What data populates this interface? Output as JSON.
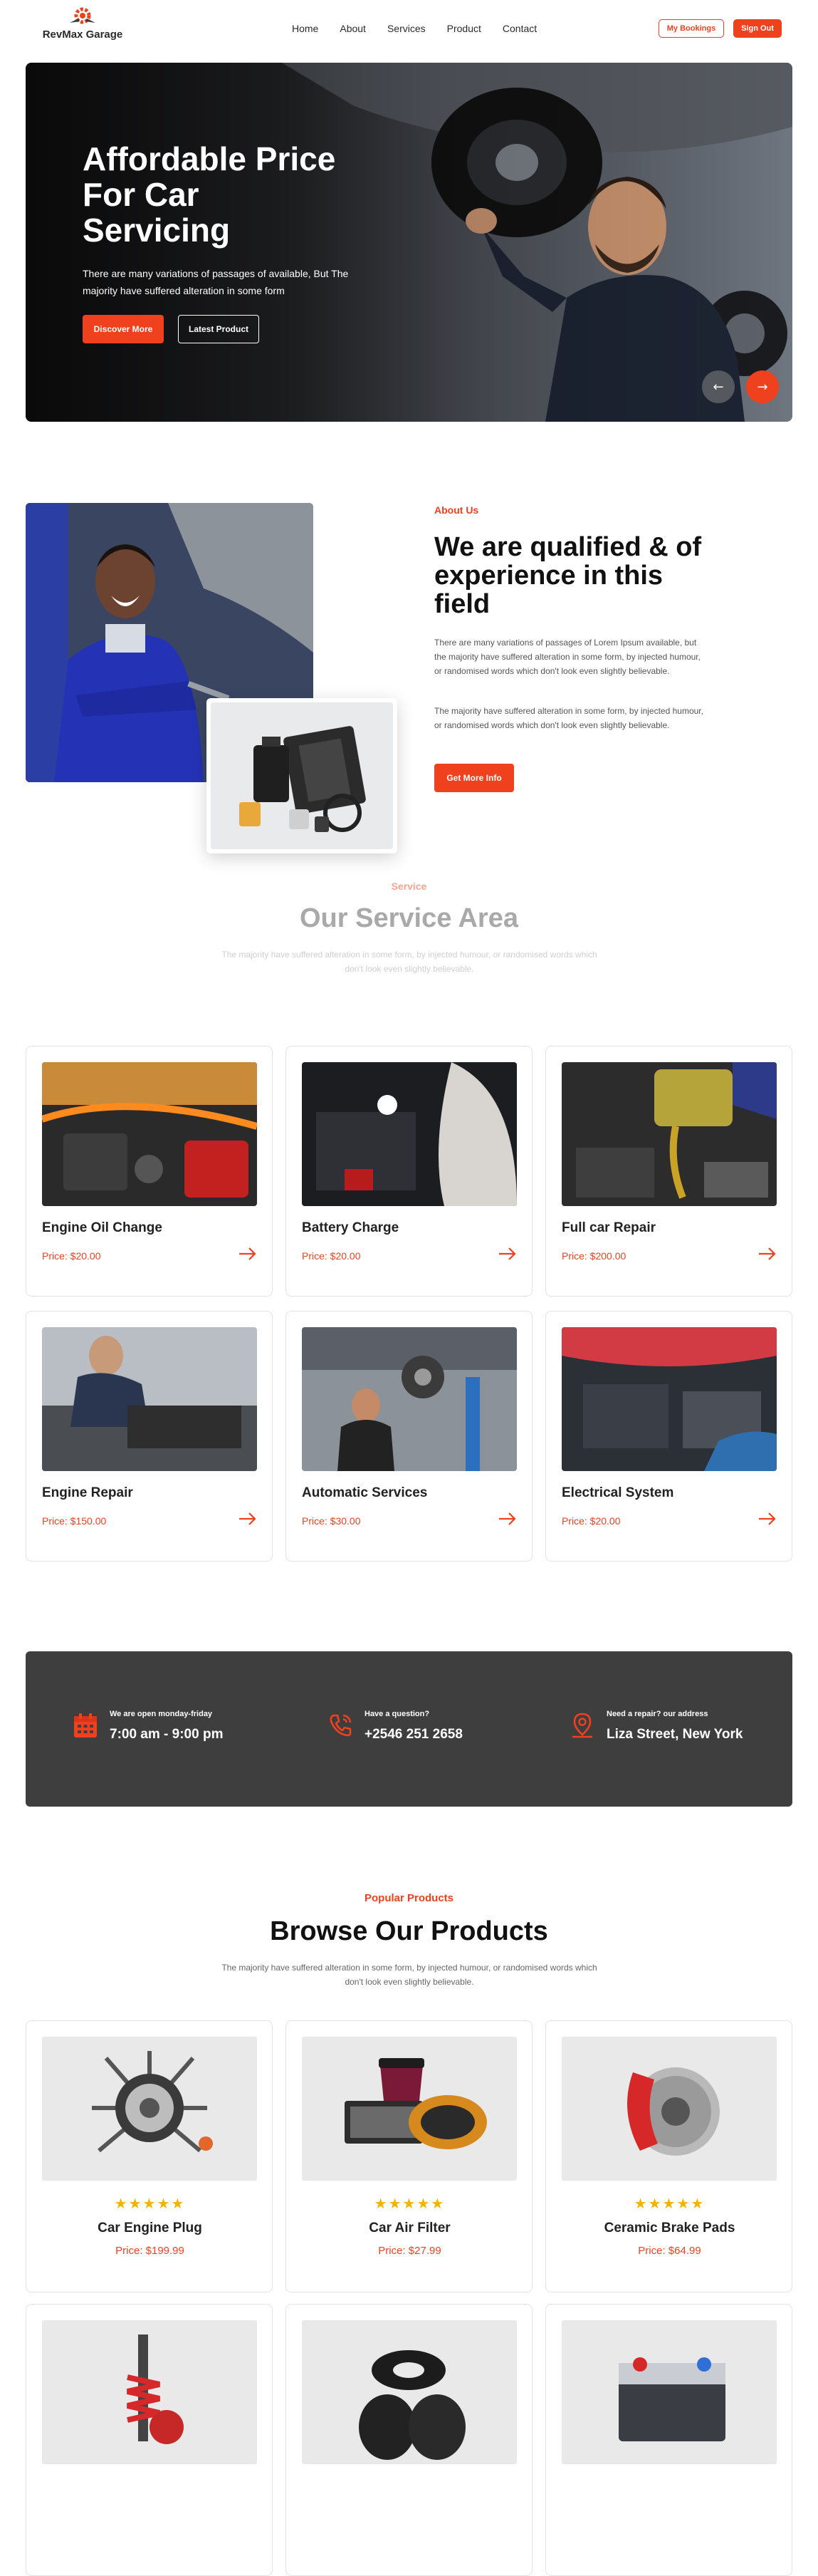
{
  "brand": {
    "name": "RevMax Garage",
    "accent": "#f0411f"
  },
  "nav": {
    "items": [
      "Home",
      "About",
      "Services",
      "Product",
      "Contact"
    ]
  },
  "header_buttons": {
    "bookings": "My Bookings",
    "signout": "Sign Out"
  },
  "hero": {
    "title": "Affordable Price For Car Servicing",
    "text": "There are many variations of passages of available, But The majority have suffered alteration in some form",
    "primary_button": "Discover More",
    "secondary_button": "Latest Product",
    "prev_icon": "arrow-left-icon",
    "next_icon": "arrow-right-icon"
  },
  "about": {
    "tag": "About Us",
    "title": "We are qualified & of experience in this field",
    "p1": "There are many variations of passages of Lorem Ipsum available, but the majority have suffered alteration in some form, by injected humour, or randomised words which don't look even slightly believable.",
    "p2": "The majority have suffered alteration in some form, by injected humour, or randomised words which don't look even slightly believable.",
    "button": "Get More Info"
  },
  "services": {
    "tag": "Service",
    "title": "Our Service Area",
    "subtitle": "The majority have suffered alteration in some form, by injected humour, or randomised words which don't look even slightly believable.",
    "items": [
      {
        "name": "Engine Oil Change",
        "price": "Price: $20.00"
      },
      {
        "name": "Battery Charge",
        "price": "Price: $20.00"
      },
      {
        "name": "Full car Repair",
        "price": "Price: $200.00"
      },
      {
        "name": "Engine Repair",
        "price": "Price: $150.00"
      },
      {
        "name": "Automatic Services",
        "price": "Price: $30.00"
      },
      {
        "name": "Electrical System",
        "price": "Price: $20.00"
      }
    ]
  },
  "info": {
    "hours": {
      "label": "We are open monday-friday",
      "value": "7:00 am - 9:00 pm",
      "icon": "calendar-icon"
    },
    "phone": {
      "label": "Have a question?",
      "value": "+2546 251 2658",
      "icon": "phone-icon"
    },
    "address": {
      "label": "Need a repair? our address",
      "value": "Liza Street, New York",
      "icon": "location-pin-icon"
    }
  },
  "products": {
    "tag": "Popular Products",
    "title": "Browse Our Products",
    "subtitle": "The majority have suffered alteration in some form, by injected humour, or randomised words which don't look even slightly believable.",
    "stars": "★★★★★",
    "rating": 5,
    "items": [
      {
        "name": "Car Engine Plug",
        "price": "Price: $199.99"
      },
      {
        "name": "Car Air Filter",
        "price": "Price: $27.99"
      },
      {
        "name": "Ceramic Brake Pads",
        "price": "Price: $64.99"
      }
    ]
  }
}
